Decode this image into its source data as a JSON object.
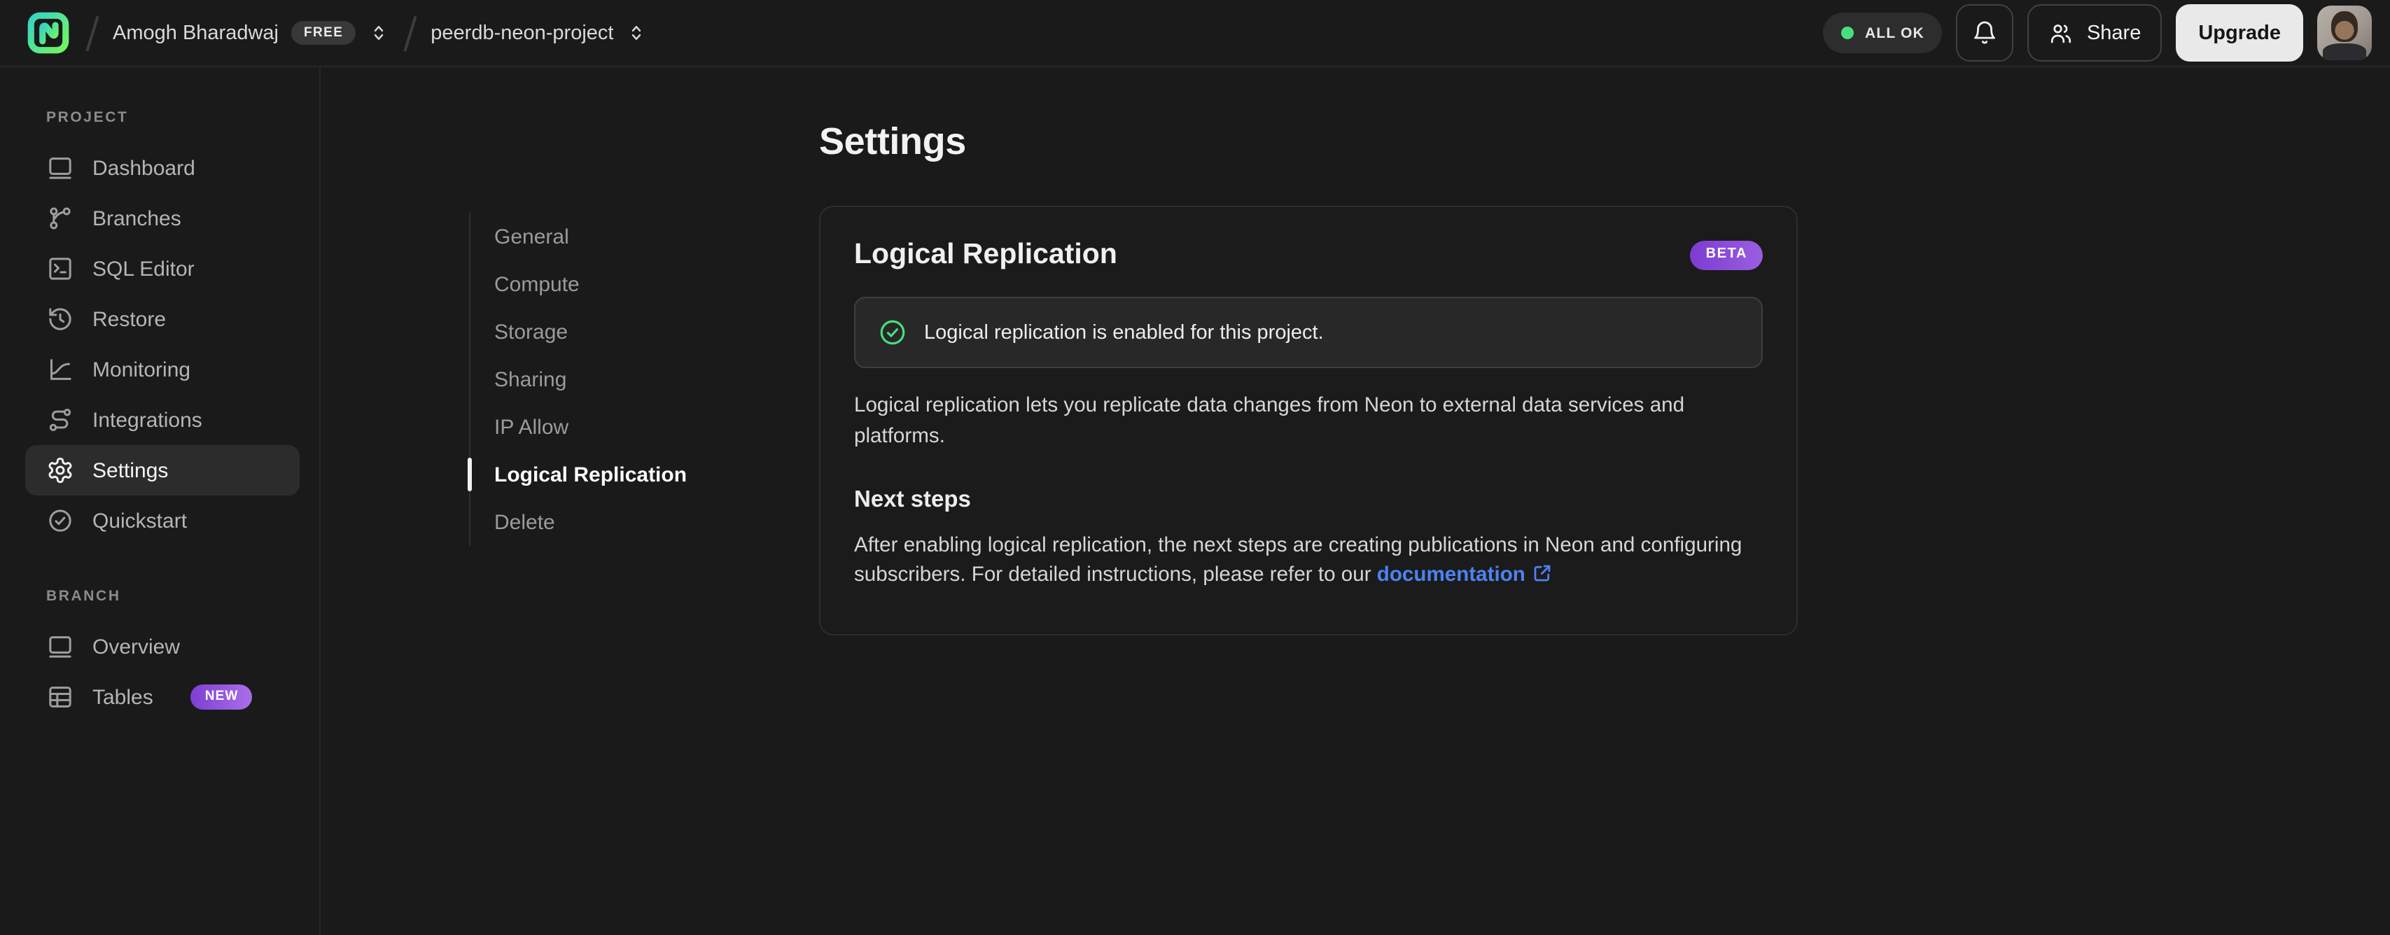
{
  "topbar": {
    "org": {
      "name": "Amogh Bharadwaj",
      "plan_badge": "FREE"
    },
    "project": {
      "name": "peerdb-neon-project"
    },
    "status_badge": "ALL OK",
    "share_label": "Share",
    "upgrade_label": "Upgrade"
  },
  "sidebar": {
    "sections": [
      {
        "label": "PROJECT",
        "items": [
          {
            "label": "Dashboard",
            "icon": "window-icon",
            "active": false
          },
          {
            "label": "Branches",
            "icon": "git-branch-icon",
            "active": false
          },
          {
            "label": "SQL Editor",
            "icon": "terminal-icon",
            "active": false
          },
          {
            "label": "Restore",
            "icon": "history-icon",
            "active": false
          },
          {
            "label": "Monitoring",
            "icon": "chart-curve-icon",
            "active": false
          },
          {
            "label": "Integrations",
            "icon": "route-icon",
            "active": false
          },
          {
            "label": "Settings",
            "icon": "gear-icon",
            "active": true
          },
          {
            "label": "Quickstart",
            "icon": "check-circle-icon",
            "active": false
          }
        ]
      },
      {
        "label": "BRANCH",
        "items": [
          {
            "label": "Overview",
            "icon": "window-icon",
            "active": false
          },
          {
            "label": "Tables",
            "icon": "table-icon",
            "active": false,
            "badge": "NEW"
          }
        ]
      }
    ]
  },
  "settings_nav": {
    "items": [
      "General",
      "Compute",
      "Storage",
      "Sharing",
      "IP Allow",
      "Logical Replication",
      "Delete"
    ],
    "active_item": "Logical Replication"
  },
  "main": {
    "title": "Settings",
    "card": {
      "title": "Logical Replication",
      "badge": "BETA",
      "alert_text": "Logical replication is enabled for this project.",
      "description": "Logical replication lets you replicate data changes from Neon to external data services and platforms.",
      "next_steps_heading": "Next steps",
      "next_steps_text": "After enabling logical replication, the next steps are creating publications in Neon and configuring subscribers. For detailed instructions, please refer to our",
      "doc_link_label": "documentation"
    }
  },
  "colors": {
    "background": "#1a1a1a",
    "card_border": "#2d2d2d",
    "status_green": "#4ade80",
    "badge_purple_start": "#7d3bd3",
    "badge_purple_end": "#9a5ee0",
    "link_blue": "#4d82f2",
    "upgrade_button_bg": "#e9e9e9"
  }
}
